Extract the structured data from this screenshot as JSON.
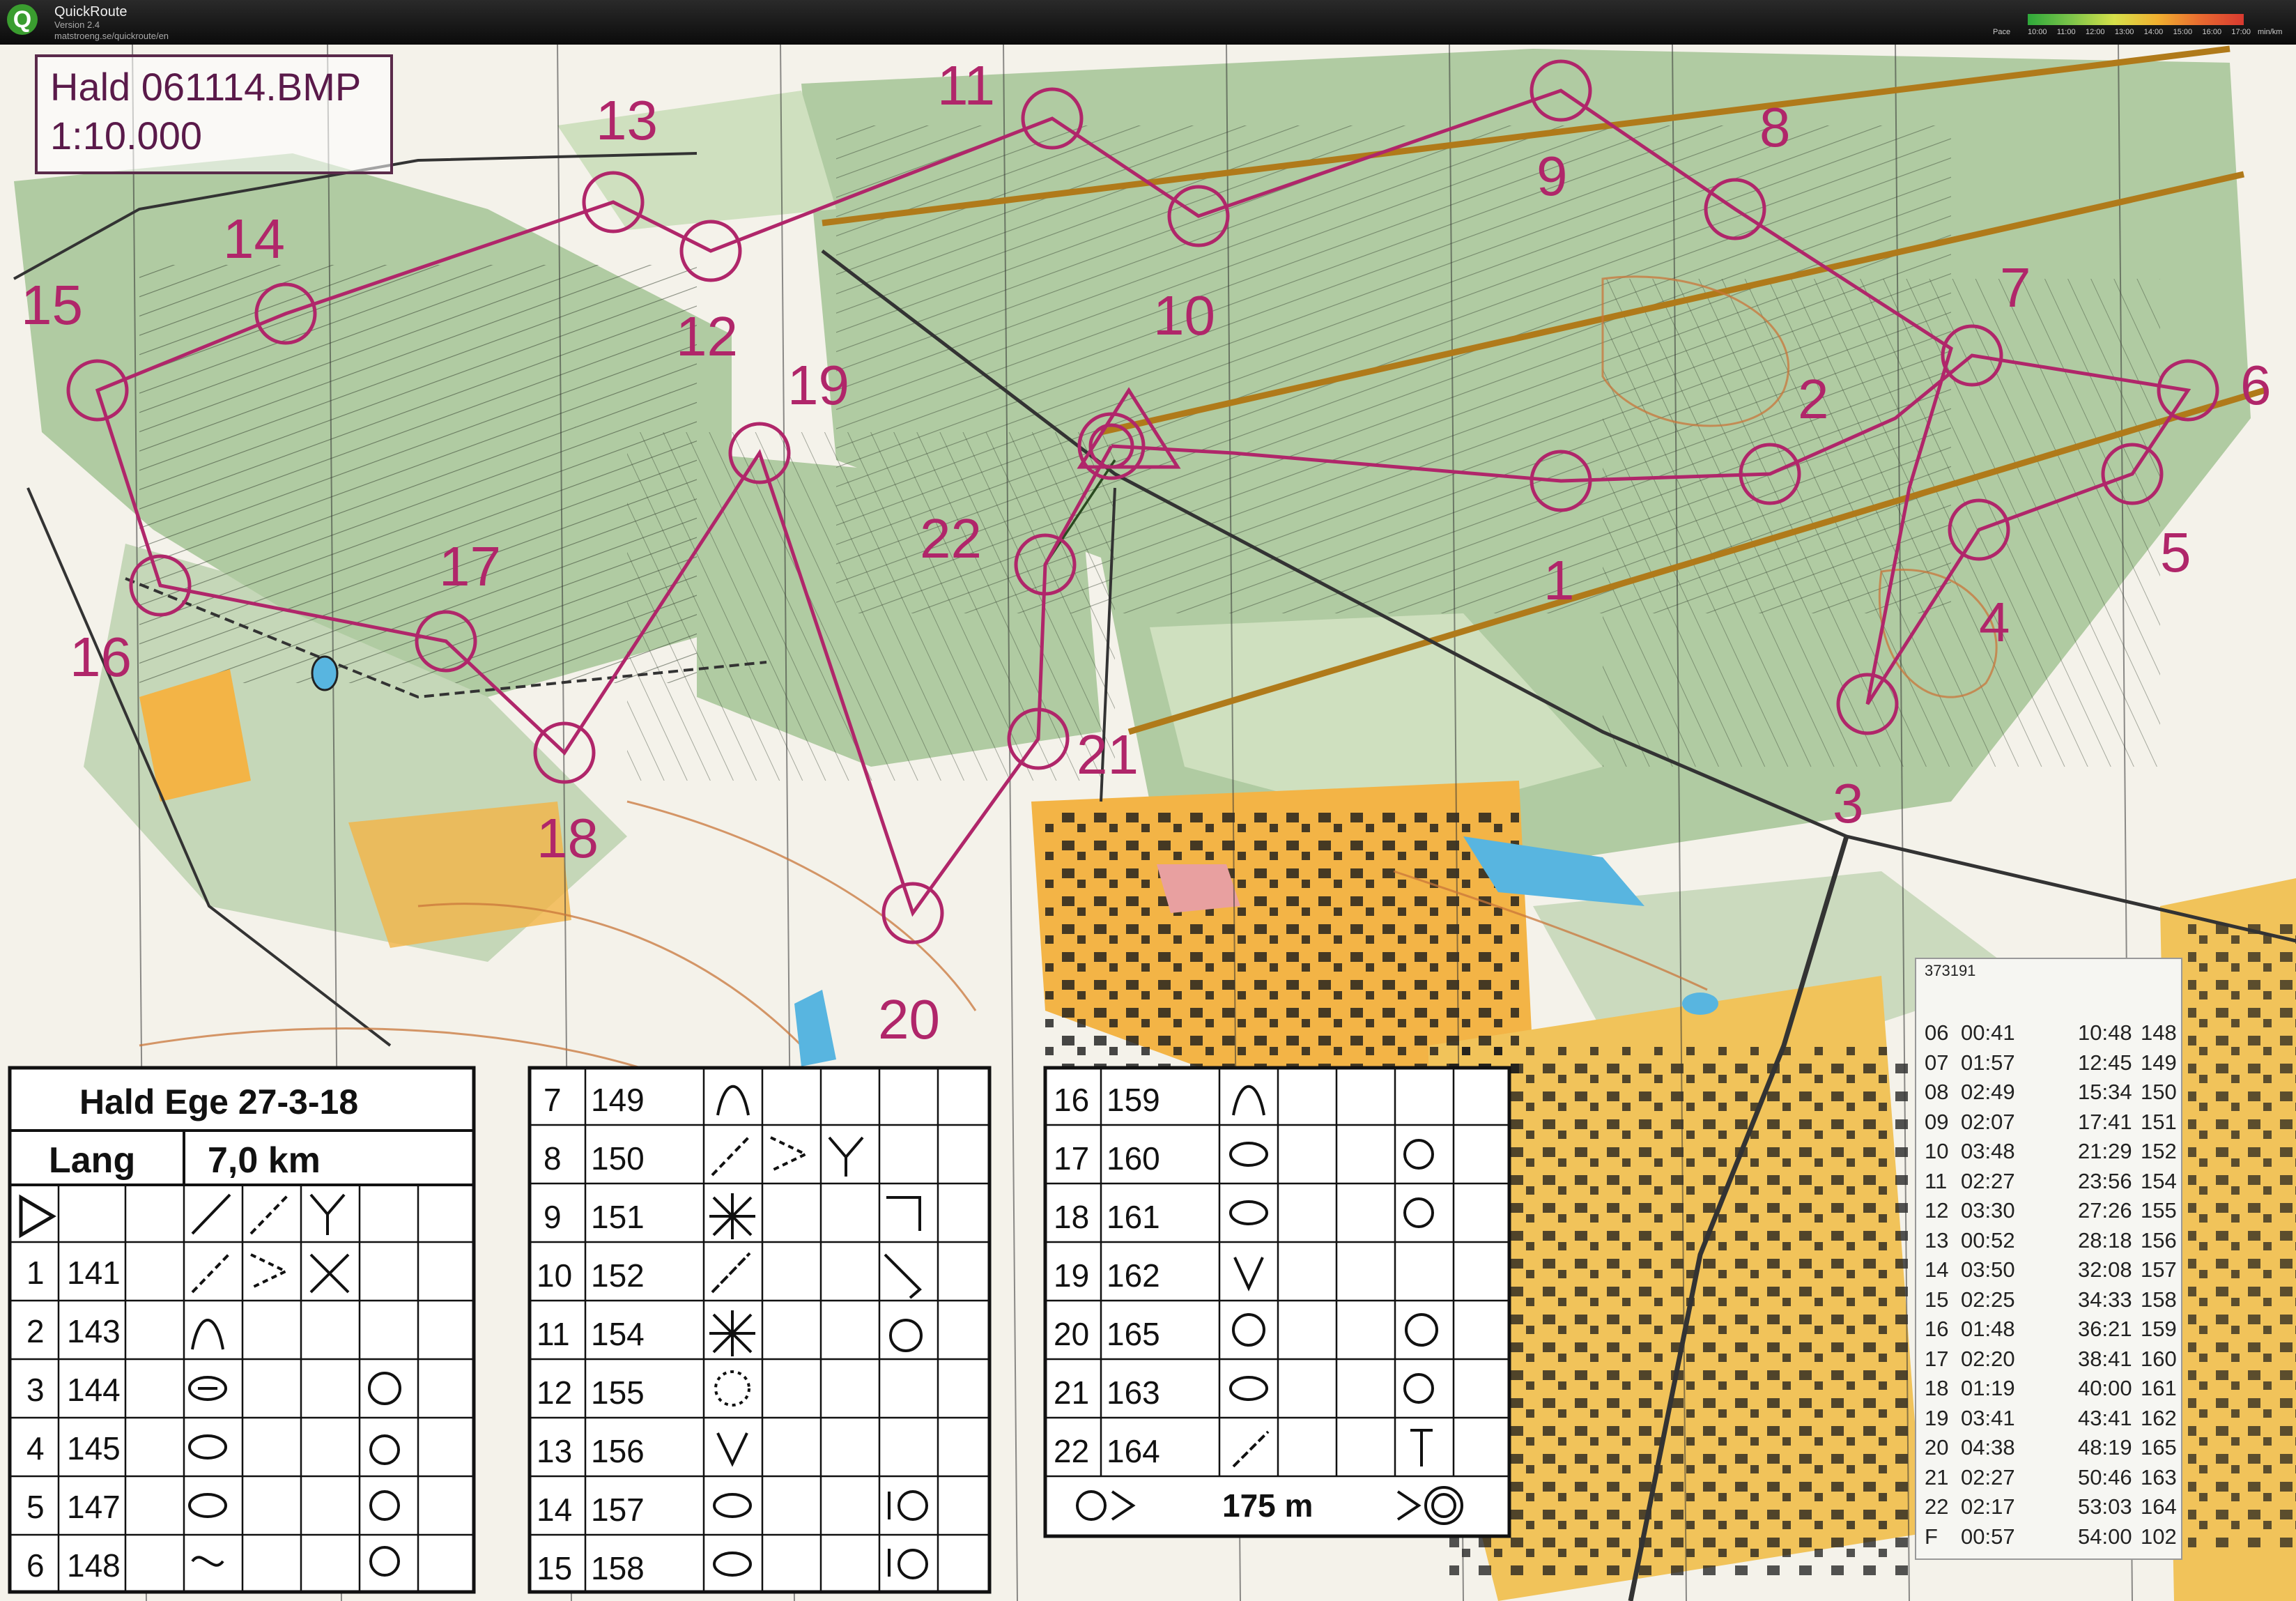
{
  "window": {
    "app_title": "QuickRoute",
    "version": "Version 2.4",
    "url": "matstroeng.se/quickroute/en"
  },
  "pace_legend": {
    "label": "Pace",
    "ticks": [
      "10:00",
      "11:00",
      "12:00",
      "13:00",
      "14:00",
      "15:00",
      "16:00",
      "17:00"
    ],
    "unit": "min/km"
  },
  "map_header": {
    "name": "Hald 061114.BMP",
    "scale": "1:10.000"
  },
  "controls": [
    {
      "label": "1"
    },
    {
      "label": "2"
    },
    {
      "label": "3"
    },
    {
      "label": "4"
    },
    {
      "label": "5"
    },
    {
      "label": "6"
    },
    {
      "label": "7"
    },
    {
      "label": "8"
    },
    {
      "label": "9"
    },
    {
      "label": "10"
    },
    {
      "label": "11"
    },
    {
      "label": "12"
    },
    {
      "label": "13"
    },
    {
      "label": "14"
    },
    {
      "label": "15"
    },
    {
      "label": "16"
    },
    {
      "label": "17"
    },
    {
      "label": "18"
    },
    {
      "label": "19"
    },
    {
      "label": "20"
    },
    {
      "label": "21"
    },
    {
      "label": "22"
    }
  ],
  "description_sheet": {
    "event": "Hald Ege 27-3-18",
    "class": "Lang",
    "length": "7,0 km",
    "table1": [
      {
        "n": "1",
        "code": "141"
      },
      {
        "n": "2",
        "code": "143"
      },
      {
        "n": "3",
        "code": "144"
      },
      {
        "n": "4",
        "code": "145"
      },
      {
        "n": "5",
        "code": "147"
      },
      {
        "n": "6",
        "code": "148"
      }
    ],
    "table2": [
      {
        "n": "7",
        "code": "149"
      },
      {
        "n": "8",
        "code": "150"
      },
      {
        "n": "9",
        "code": "151"
      },
      {
        "n": "10",
        "code": "152"
      },
      {
        "n": "11",
        "code": "154"
      },
      {
        "n": "12",
        "code": "155"
      },
      {
        "n": "13",
        "code": "156"
      },
      {
        "n": "14",
        "code": "157"
      },
      {
        "n": "15",
        "code": "158"
      }
    ],
    "table3": [
      {
        "n": "16",
        "code": "159"
      },
      {
        "n": "17",
        "code": "160"
      },
      {
        "n": "18",
        "code": "161"
      },
      {
        "n": "19",
        "code": "162"
      },
      {
        "n": "20",
        "code": "165"
      },
      {
        "n": "21",
        "code": "163"
      },
      {
        "n": "22",
        "code": "164"
      }
    ],
    "finish_distance": "175 m"
  },
  "splits": {
    "header": "373191",
    "rows": [
      {
        "ctl": "06",
        "split": "00:41",
        "total": "10:48",
        "code": "148"
      },
      {
        "ctl": "07",
        "split": "01:57",
        "total": "12:45",
        "code": "149"
      },
      {
        "ctl": "08",
        "split": "02:49",
        "total": "15:34",
        "code": "150"
      },
      {
        "ctl": "09",
        "split": "02:07",
        "total": "17:41",
        "code": "151"
      },
      {
        "ctl": "10",
        "split": "03:48",
        "total": "21:29",
        "code": "152"
      },
      {
        "ctl": "11",
        "split": "02:27",
        "total": "23:56",
        "code": "154"
      },
      {
        "ctl": "12",
        "split": "03:30",
        "total": "27:26",
        "code": "155"
      },
      {
        "ctl": "13",
        "split": "00:52",
        "total": "28:18",
        "code": "156"
      },
      {
        "ctl": "14",
        "split": "03:50",
        "total": "32:08",
        "code": "157"
      },
      {
        "ctl": "15",
        "split": "02:25",
        "total": "34:33",
        "code": "158"
      },
      {
        "ctl": "16",
        "split": "01:48",
        "total": "36:21",
        "code": "159"
      },
      {
        "ctl": "17",
        "split": "02:20",
        "total": "38:41",
        "code": "160"
      },
      {
        "ctl": "18",
        "split": "01:19",
        "total": "40:00",
        "code": "161"
      },
      {
        "ctl": "19",
        "split": "03:41",
        "total": "43:41",
        "code": "162"
      },
      {
        "ctl": "20",
        "split": "04:38",
        "total": "48:19",
        "code": "165"
      },
      {
        "ctl": "21",
        "split": "02:27",
        "total": "50:46",
        "code": "163"
      },
      {
        "ctl": "22",
        "split": "02:17",
        "total": "53:03",
        "code": "164"
      },
      {
        "ctl": "F",
        "split": "00:57",
        "total": "54:00",
        "code": "102"
      }
    ]
  }
}
